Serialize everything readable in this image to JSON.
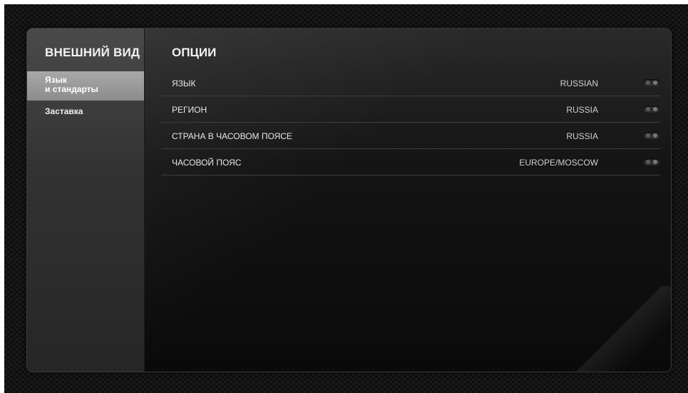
{
  "sidebar": {
    "title": "ВНЕШНИЙ ВИД",
    "items": [
      {
        "line1": "Язык",
        "line2": "и стандарты",
        "active": true
      },
      {
        "label": "Заставка",
        "active": false
      }
    ]
  },
  "main": {
    "title": "ОПЦИИ",
    "options": [
      {
        "label": "ЯЗЫК",
        "value": "RUSSIAN",
        "icon": "toggle-icon"
      },
      {
        "label": "РЕГИОН",
        "value": "RUSSIA",
        "icon": "toggle-icon"
      },
      {
        "label": "СТРАНА В ЧАСОВОМ ПОЯСЕ",
        "value": "RUSSIA",
        "icon": "toggle-icon"
      },
      {
        "label": "ЧАСОВОЙ ПОЯС",
        "value": "EUROPE/MOSCOW",
        "icon": "toggle-icon"
      }
    ]
  },
  "colors": {
    "background": "#0c0c0c",
    "sidebar": "#333333",
    "active_item": "#9a9a9a",
    "text": "#f0f0f0"
  }
}
